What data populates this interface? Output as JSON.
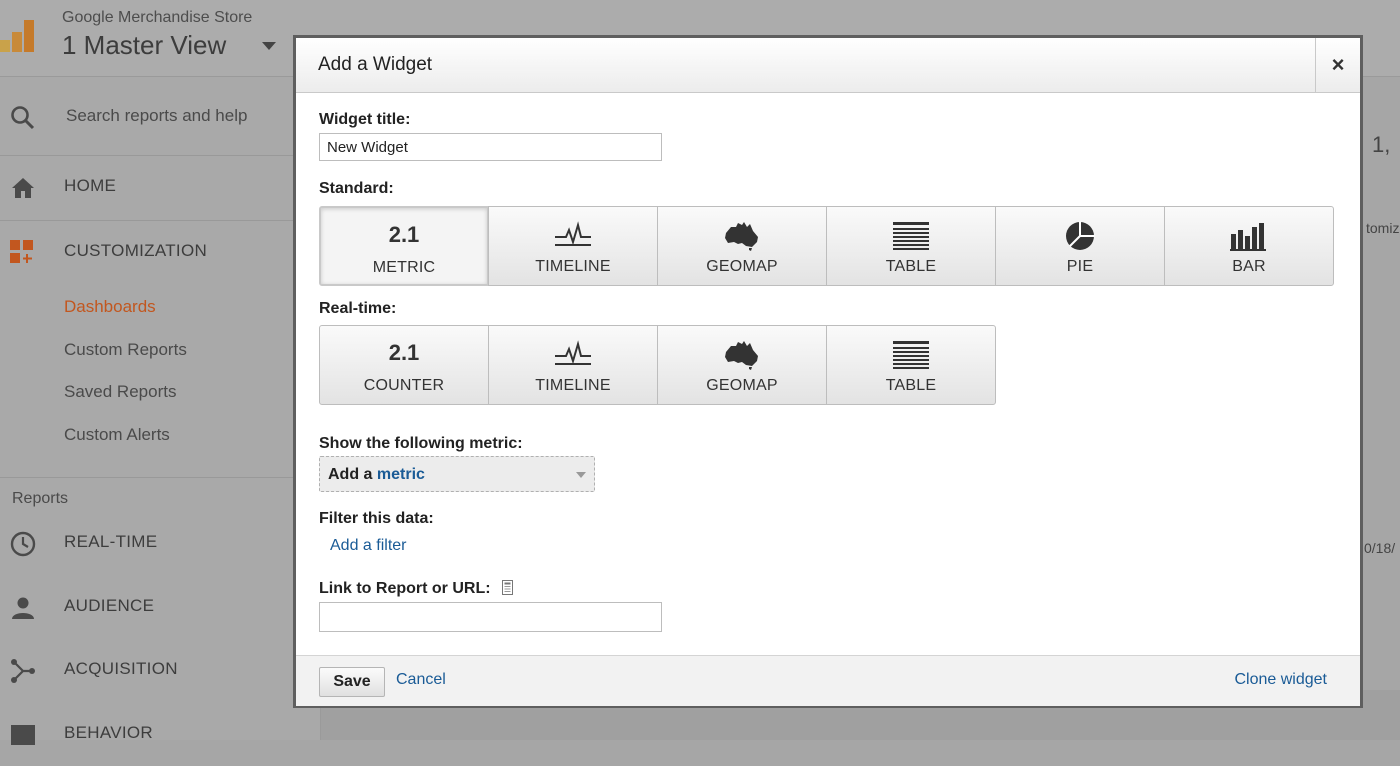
{
  "app": {
    "store_name": "Google Merchandise Store",
    "view_name": "1 Master View"
  },
  "sidebar": {
    "search_placeholder": "Search reports and help",
    "home_label": "HOME",
    "customization_label": "CUSTOMIZATION",
    "sub_items": [
      "Dashboards",
      "Custom Reports",
      "Saved Reports",
      "Custom Alerts"
    ],
    "active_sub_item": "Dashboards",
    "reports_header": "Reports",
    "report_items": [
      "REAL-TIME",
      "AUDIENCE",
      "ACQUISITION",
      "BEHAVIOR"
    ]
  },
  "background": {
    "fragment_top": "1, ",
    "fragment_mid": "tomiz",
    "fragment_date": "0/18/"
  },
  "modal": {
    "title": "Add a Widget",
    "close_symbol": "×",
    "widget_title_label": "Widget title:",
    "widget_title_value": "New Widget",
    "standard_label": "Standard:",
    "standard_types": [
      {
        "label": "METRIC",
        "icon": "number-2.1",
        "glyph": "2.1",
        "selected": true
      },
      {
        "label": "TIMELINE",
        "icon": "timeline-icon",
        "selected": false
      },
      {
        "label": "GEOMAP",
        "icon": "australia-map-icon",
        "selected": false
      },
      {
        "label": "TABLE",
        "icon": "table-icon",
        "selected": false
      },
      {
        "label": "PIE",
        "icon": "pie-icon",
        "selected": false
      },
      {
        "label": "BAR",
        "icon": "bar-chart-icon",
        "selected": false
      }
    ],
    "realtime_label": "Real-time:",
    "realtime_types": [
      {
        "label": "COUNTER",
        "icon": "number-2.1",
        "glyph": "2.1"
      },
      {
        "label": "TIMELINE",
        "icon": "timeline-icon"
      },
      {
        "label": "GEOMAP",
        "icon": "australia-map-icon"
      },
      {
        "label": "TABLE",
        "icon": "table-icon"
      }
    ],
    "metric_label": "Show the following metric:",
    "metric_select_prefix": "Add a",
    "metric_select_link": "metric",
    "filter_label": "Filter this data:",
    "filter_link": "Add a filter",
    "url_label": "Link to Report or URL:",
    "url_value": "",
    "save_label": "Save",
    "cancel_label": "Cancel",
    "clone_label": "Clone widget"
  },
  "colors": {
    "link": "#1a5b96",
    "active_nav": "#c2571f",
    "overlay": "#a6a6a6"
  }
}
